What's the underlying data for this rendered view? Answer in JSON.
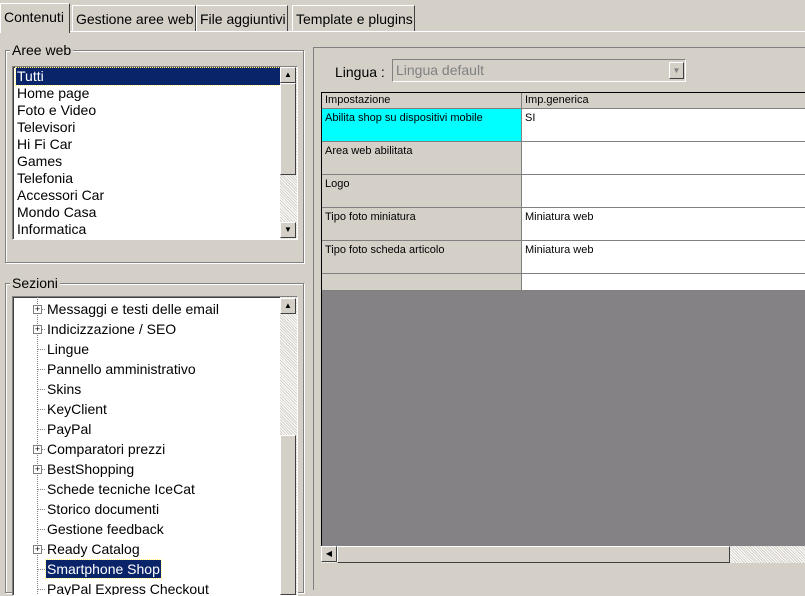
{
  "tabs": [
    {
      "label": "Contenuti",
      "active": true
    },
    {
      "label": "Gestione aree web"
    },
    {
      "label": "File aggiuntivi"
    },
    {
      "label": "Template e plugins"
    }
  ],
  "aree_web": {
    "legend": "Aree web",
    "items": [
      "Tutti",
      "Home page",
      "Foto e Video",
      "Televisori",
      "Hi Fi Car",
      "Games",
      "Telefonia",
      "Accessori Car",
      "Mondo Casa",
      "Informatica"
    ],
    "selected": "Tutti"
  },
  "sezioni": {
    "legend": "Sezioni",
    "items": [
      {
        "label": "Messaggi e testi delle email",
        "expandable": true
      },
      {
        "label": "Indicizzazione / SEO",
        "expandable": true
      },
      {
        "label": "Lingue",
        "expandable": false
      },
      {
        "label": "Pannello amministrativo",
        "expandable": false
      },
      {
        "label": "Skins",
        "expandable": false
      },
      {
        "label": "KeyClient",
        "expandable": false
      },
      {
        "label": "PayPal",
        "expandable": false
      },
      {
        "label": "Comparatori prezzi",
        "expandable": true
      },
      {
        "label": "BestShopping",
        "expandable": true
      },
      {
        "label": "Schede tecniche IceCat",
        "expandable": false
      },
      {
        "label": "Storico documenti",
        "expandable": false
      },
      {
        "label": "Gestione feedback",
        "expandable": false
      },
      {
        "label": "Ready Catalog",
        "expandable": true
      },
      {
        "label": "Smartphone Shop",
        "expandable": false,
        "selected": true
      },
      {
        "label": "PayPal Express Checkout",
        "expandable": false
      }
    ]
  },
  "lingua": {
    "label": "Lingua :",
    "value": "Lingua default"
  },
  "grid": {
    "columns": [
      "Impostazione",
      "Imp.generica"
    ],
    "rows": [
      {
        "name": "Abilita shop su dispositivi mobile",
        "value": "SI",
        "highlight": true
      },
      {
        "name": "Area web abilitata",
        "value": ""
      },
      {
        "name": "Logo",
        "value": ""
      },
      {
        "name": "Tipo foto miniatura",
        "value": "Miniatura web"
      },
      {
        "name": "Tipo foto scheda articolo",
        "value": "Miniatura web"
      }
    ]
  },
  "colors": {
    "selection": "#0a246a",
    "highlight_cell": "#00ffff",
    "grid_empty": "#848284",
    "face": "#d4d0c8"
  }
}
